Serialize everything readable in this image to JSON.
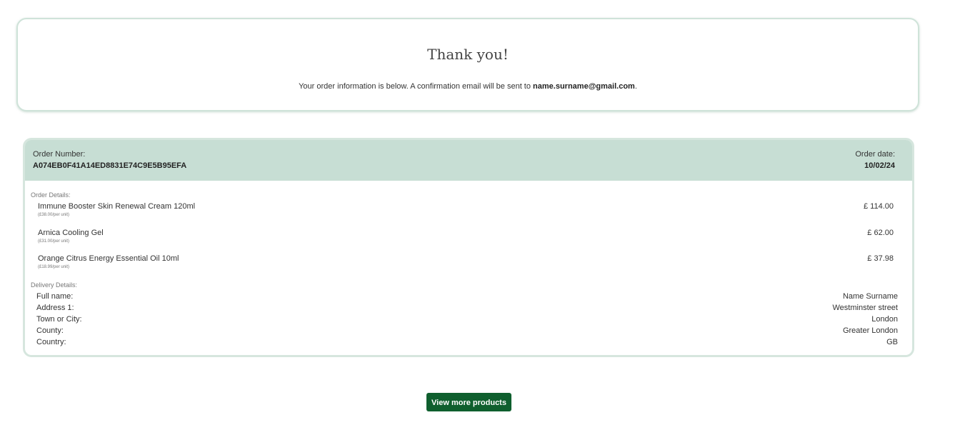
{
  "confirmation": {
    "title": "Thank you!",
    "message_prefix": "Your order information is below. A confirmation email will be sent to ",
    "email": "name.surname@gmail.com",
    "message_suffix": "."
  },
  "order": {
    "number_label": "Order Number:",
    "number": "A074EB0F41A14ED8831E74C9E5B95EFA",
    "date_label": "Order date:",
    "date": "10/02/24"
  },
  "details": {
    "label": "Order Details:",
    "items": [
      {
        "name": "Immune Booster Skin Renewal Cream 120ml",
        "unit": "(£38.00/per unit)",
        "price": "£ 114.00"
      },
      {
        "name": "Arnica Cooling Gel",
        "unit": "(£31.00/per unit)",
        "price": "£ 62.00"
      },
      {
        "name": "Orange Citrus Energy Essential Oil 10ml",
        "unit": "(£18.99/per unit)",
        "price": "£ 37.98"
      }
    ]
  },
  "delivery": {
    "label": "Delivery Details:",
    "rows": [
      {
        "label": "Full name:",
        "value": "Name Surname"
      },
      {
        "label": "Address 1:",
        "value": "Westminster street"
      },
      {
        "label": "Town or City:",
        "value": "London"
      },
      {
        "label": "County:",
        "value": "Greater London"
      },
      {
        "label": "Country:",
        "value": "GB"
      }
    ]
  },
  "actions": {
    "view_more_label": "View more products"
  },
  "colors": {
    "header_bg": "#c7ded4",
    "card_border": "#cfe3d9",
    "button_bg": "#0f5f2e"
  }
}
